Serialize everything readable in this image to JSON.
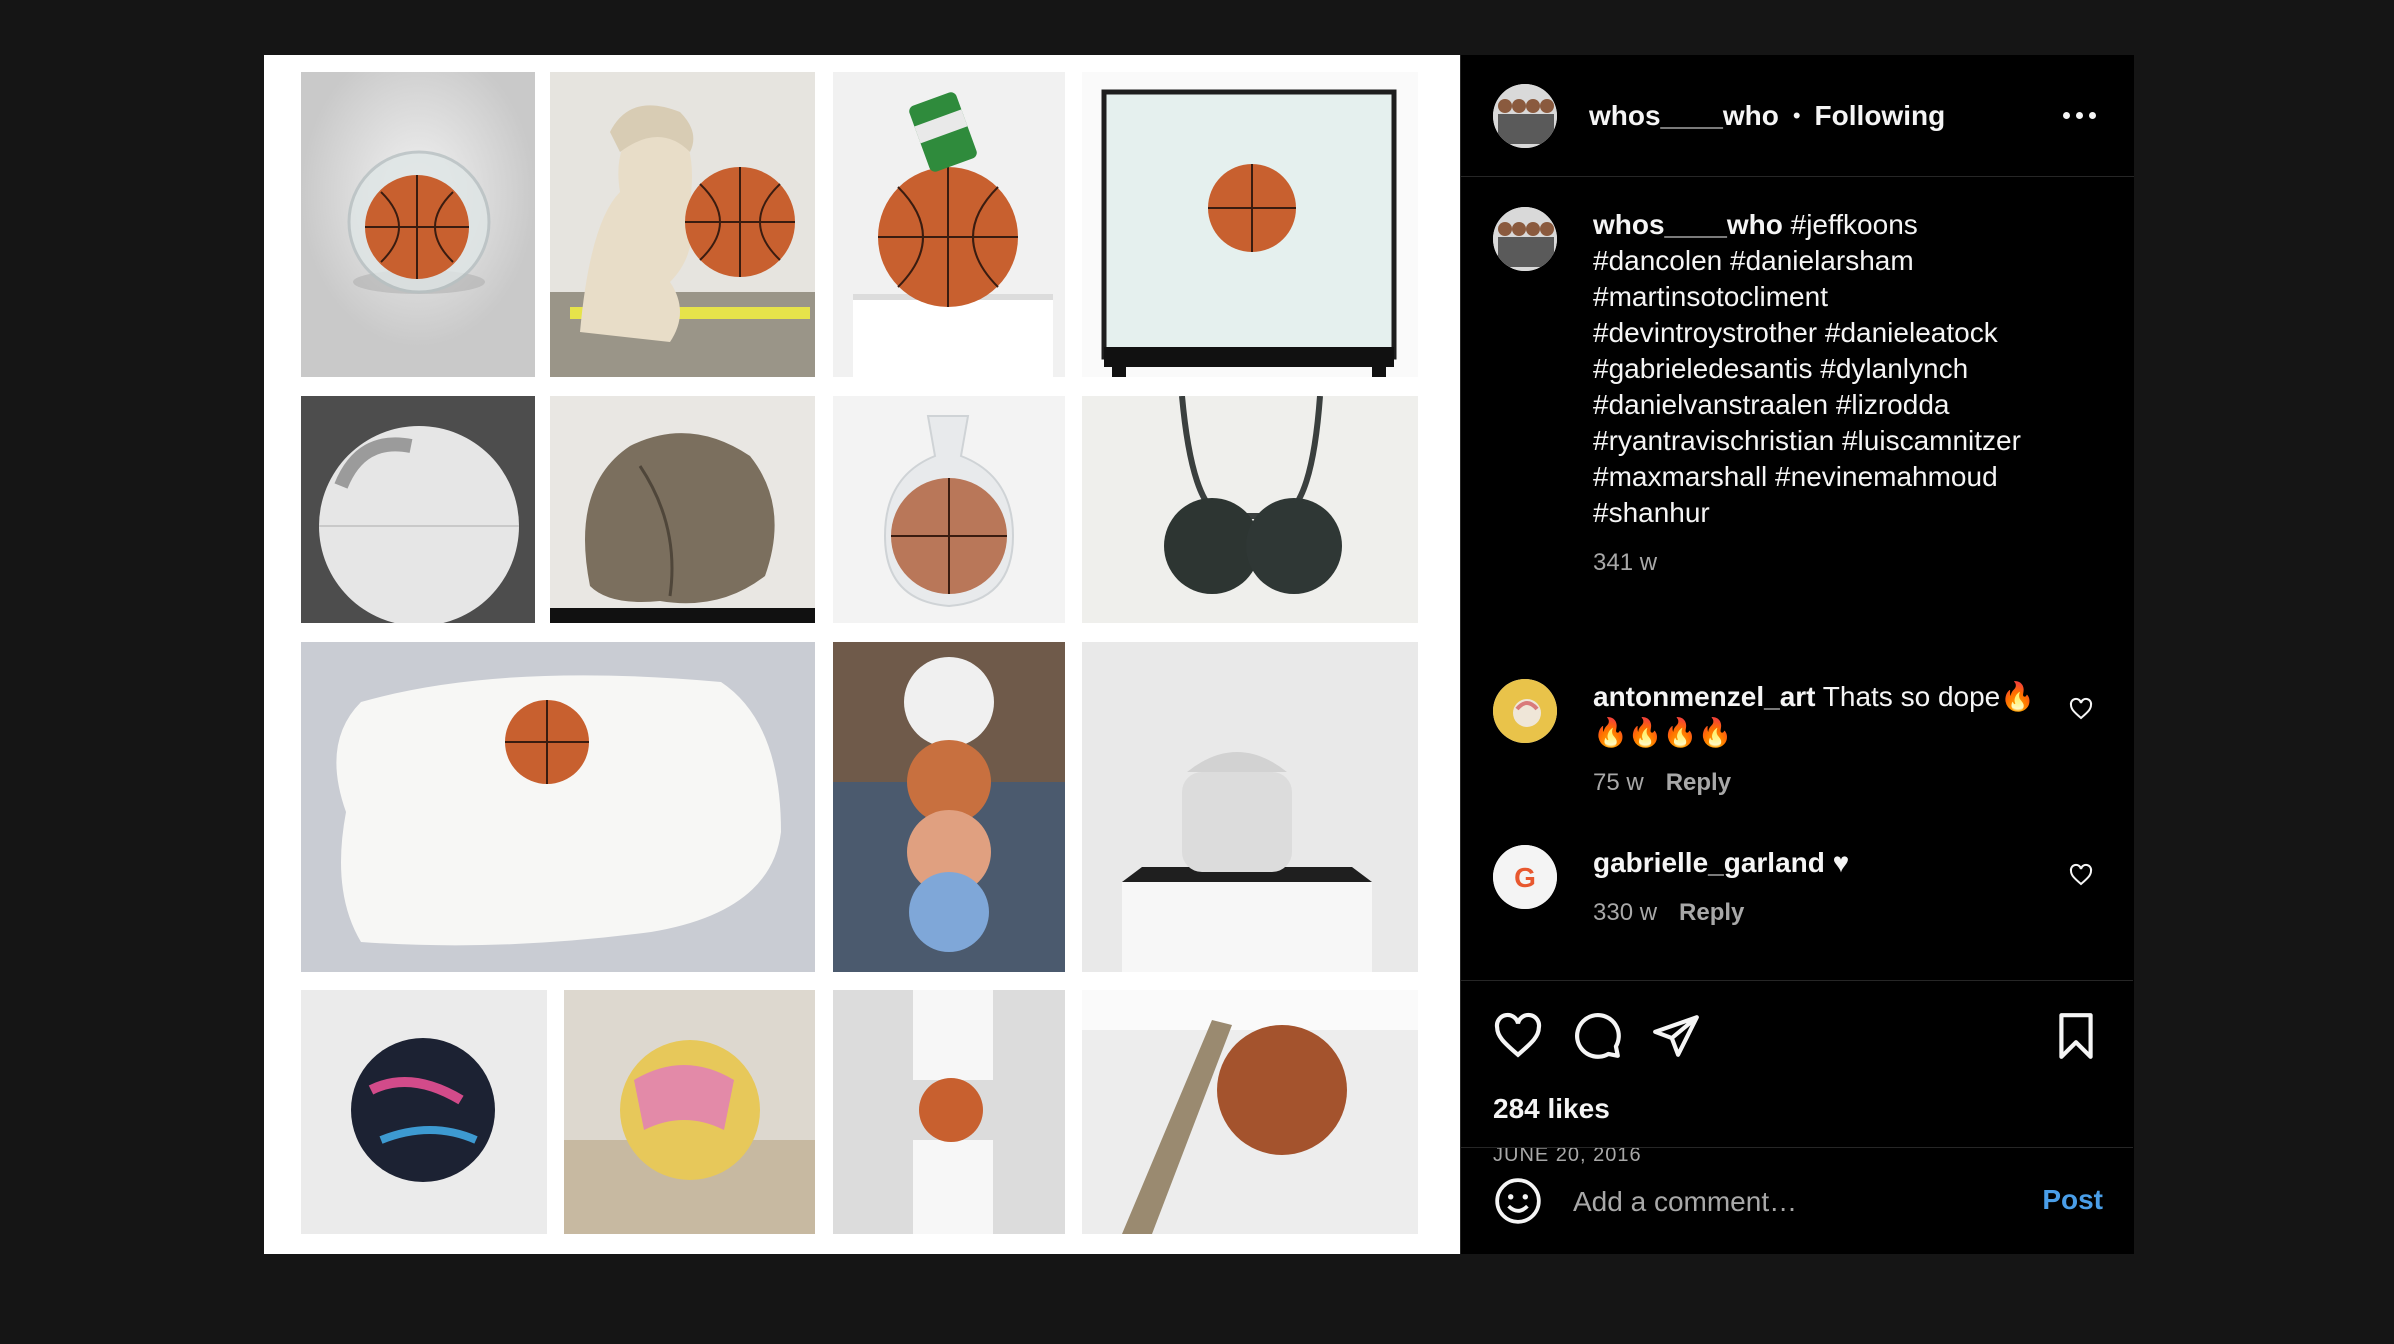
{
  "post": {
    "username": "whos____who",
    "separator": "•",
    "follow_status": "Following",
    "caption_lines": [
      "#jeffkoons",
      "#dancolen #danielarsham",
      "#martinsotocliment",
      "#devintroystrother #danieleatock",
      "#gabrieledesantis #dylanlynch",
      "#danielvanstraalen #lizrodda",
      "#ryantravischristian #luiscamnitzer",
      "#maxmarshall #nevinemahmoud",
      "#shanhur"
    ],
    "caption_age": "341 w",
    "likes": "284 likes",
    "date": "JUNE 20, 2016"
  },
  "comments": [
    {
      "username": "antonmenzel_art",
      "text_line1": "Thats so dope🔥",
      "text_line2": "🔥🔥🔥🔥",
      "age": "75 w",
      "reply": "Reply",
      "avatar_color": "#e9c34a"
    },
    {
      "username": "gabrielle_garland",
      "text_line1": "♥",
      "age": "330 w",
      "reply": "Reply",
      "avatar_color": "#f4f4f4"
    }
  ],
  "composer": {
    "placeholder": "Add a comment…",
    "post_label": "Post"
  },
  "icons": [
    "more-icon",
    "heart-icon",
    "comment-icon",
    "share-icon",
    "bookmark-icon",
    "emoji-icon"
  ],
  "colors": {
    "accent": "#4a9ee8",
    "basketball": "#c8602f",
    "background": "#151515"
  }
}
